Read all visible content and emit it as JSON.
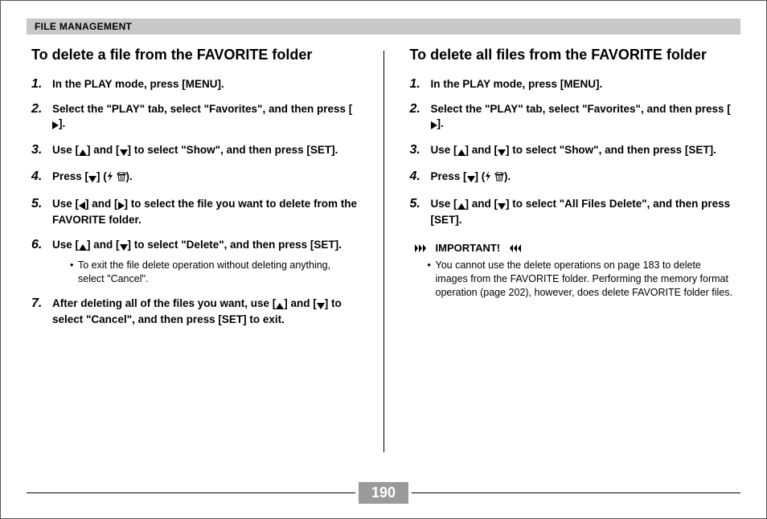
{
  "header": {
    "title": "FILE MANAGEMENT"
  },
  "left": {
    "title": "To delete a file from the FAVORITE folder",
    "steps": [
      {
        "n": "1.",
        "parts": [
          "In the PLAY mode, press [MENU]."
        ]
      },
      {
        "n": "2.",
        "parts": [
          "Select the \"PLAY\" tab, select \"Favorites\", and then press [",
          {
            "icon": "right"
          },
          "]."
        ]
      },
      {
        "n": "3.",
        "parts": [
          "Use [",
          {
            "icon": "up"
          },
          "] and [",
          {
            "icon": "down"
          },
          "] to select \"Show\", and then press [SET]."
        ]
      },
      {
        "n": "4.",
        "parts": [
          "Press [",
          {
            "icon": "down"
          },
          "] (",
          {
            "icon": "flash"
          },
          " ",
          {
            "icon": "trash"
          },
          ")."
        ]
      },
      {
        "n": "5.",
        "parts": [
          "Use [",
          {
            "icon": "left"
          },
          "] and [",
          {
            "icon": "right"
          },
          "] to select the file you want to delete from the FAVORITE folder."
        ]
      },
      {
        "n": "6.",
        "parts": [
          "Use [",
          {
            "icon": "up"
          },
          "] and [",
          {
            "icon": "down"
          },
          "] to select \"Delete\", and then press [SET]."
        ],
        "bullets": [
          "To exit the file delete operation without deleting anything, select \"Cancel\"."
        ]
      },
      {
        "n": "7.",
        "parts": [
          "After deleting all of the files you want, use [",
          {
            "icon": "up"
          },
          "] and [",
          {
            "icon": "down"
          },
          "] to select \"Cancel\", and then press [SET] to exit."
        ]
      }
    ]
  },
  "right": {
    "title": "To delete all files from the FAVORITE folder",
    "steps": [
      {
        "n": "1.",
        "parts": [
          "In the PLAY mode, press [MENU]."
        ]
      },
      {
        "n": "2.",
        "parts": [
          "Select the \"PLAY\" tab, select \"Favorites\", and then press [",
          {
            "icon": "right"
          },
          "]."
        ]
      },
      {
        "n": "3.",
        "parts": [
          "Use [",
          {
            "icon": "up"
          },
          "] and [",
          {
            "icon": "down"
          },
          "] to select \"Show\", and then press [SET]."
        ]
      },
      {
        "n": "4.",
        "parts": [
          "Press [",
          {
            "icon": "down"
          },
          "] (",
          {
            "icon": "flash"
          },
          " ",
          {
            "icon": "trash"
          },
          ")."
        ]
      },
      {
        "n": "5.",
        "parts": [
          "Use [",
          {
            "icon": "up"
          },
          "] and [",
          {
            "icon": "down"
          },
          "] to select \"All Files Delete\", and then press [SET]."
        ]
      }
    ],
    "important": {
      "label": "IMPORTANT!",
      "notes": [
        "You cannot use the delete operations on page 183 to delete images from the FAVORITE folder. Performing the memory format operation (page 202), however, does delete FAVORITE folder files."
      ]
    }
  },
  "page_number": "190"
}
